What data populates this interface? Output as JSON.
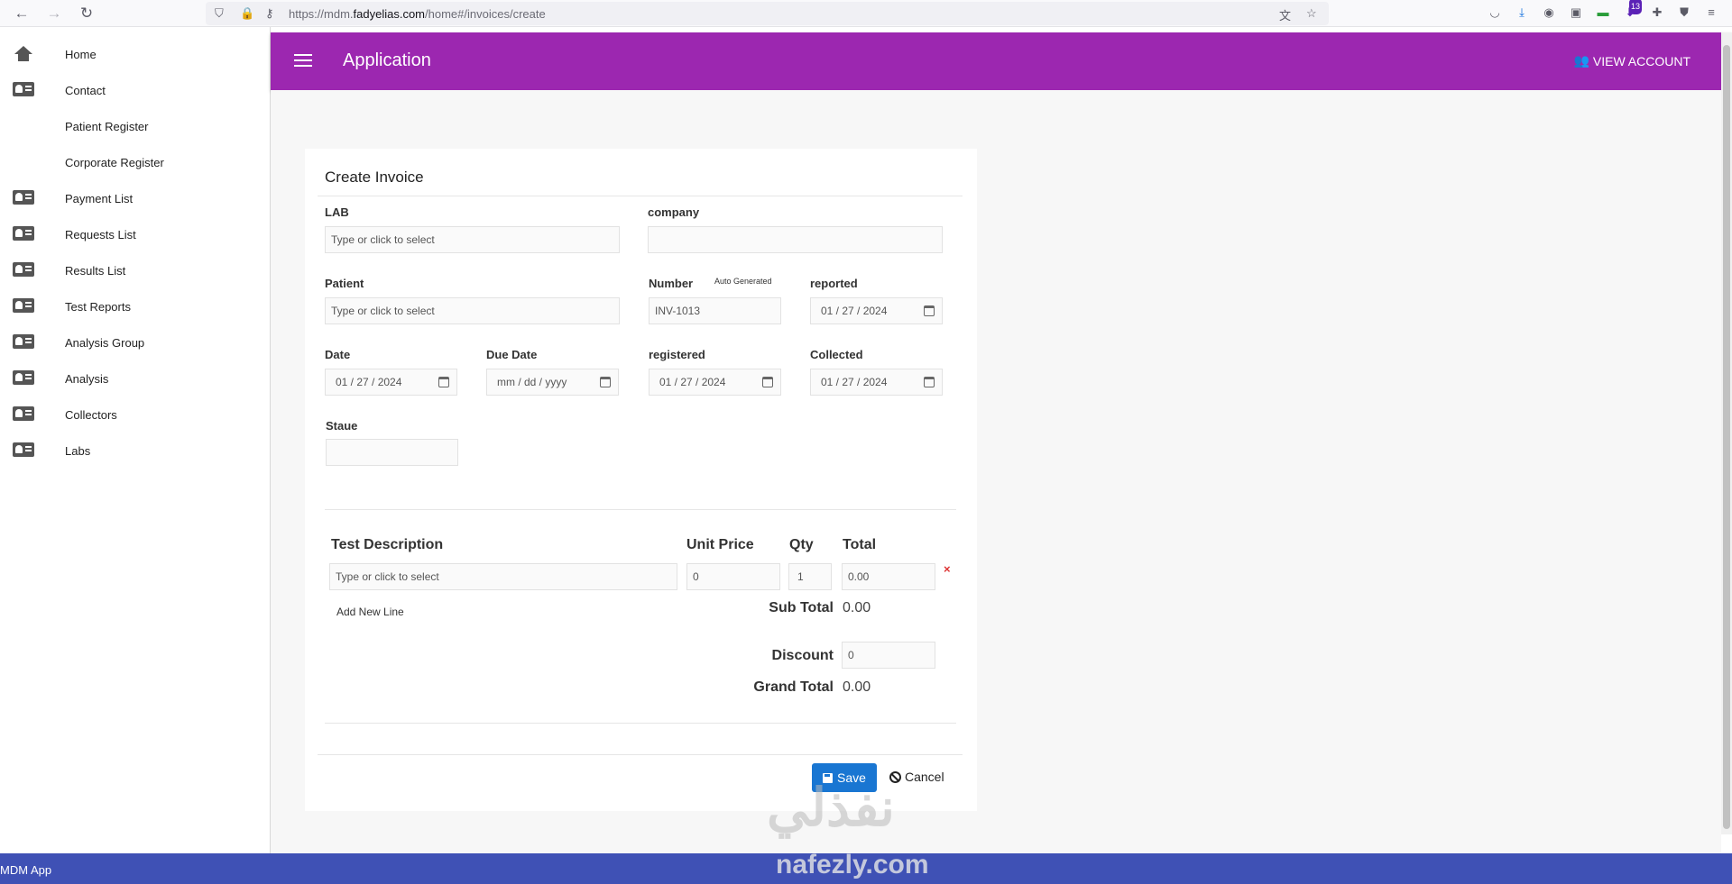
{
  "browser": {
    "url_prefix": "https://mdm.",
    "url_domain": "fadyelias.com",
    "url_path": "/home#/invoices/create",
    "notif_count": "13"
  },
  "sidebar": {
    "items": [
      {
        "label": "Home",
        "icon": "home-icon"
      },
      {
        "label": "Contact",
        "icon": "contact-card-icon"
      },
      {
        "label": "Patient Register",
        "icon": ""
      },
      {
        "label": "Corporate Register",
        "icon": ""
      },
      {
        "label": "Payment List",
        "icon": "contact-card-icon"
      },
      {
        "label": "Requests List",
        "icon": "contact-card-icon"
      },
      {
        "label": "Results List",
        "icon": "contact-card-icon"
      },
      {
        "label": "Test Reports",
        "icon": "contact-card-icon"
      },
      {
        "label": "Analysis Group",
        "icon": "contact-card-icon"
      },
      {
        "label": "Analysis",
        "icon": "contact-card-icon"
      },
      {
        "label": "Collectors",
        "icon": "contact-card-icon"
      },
      {
        "label": "Labs",
        "icon": "contact-card-icon"
      }
    ]
  },
  "appbar": {
    "title": "Application",
    "view_account": "VIEW ACCOUNT",
    "color": "#9c27b0"
  },
  "form": {
    "title": "Create Invoice",
    "lab": {
      "label": "LAB",
      "placeholder": "Type or click to select"
    },
    "company": {
      "label": "company",
      "value": ""
    },
    "patient": {
      "label": "Patient",
      "placeholder": "Type or click to select"
    },
    "number": {
      "label": "Number",
      "hint": "Auto Generated",
      "value": "INV-1013"
    },
    "reported": {
      "label": "reported",
      "value": "01 / 27 / 2024"
    },
    "date": {
      "label": "Date",
      "value": "01 / 27 / 2024"
    },
    "due_date": {
      "label": "Due Date",
      "value": "mm / dd / yyyy"
    },
    "registered": {
      "label": "registered",
      "value": "01 / 27 / 2024"
    },
    "collected": {
      "label": "Collected",
      "value": "01 / 27 / 2024"
    },
    "status": {
      "label": "Staue",
      "value": ""
    }
  },
  "table": {
    "headers": {
      "description": "Test Description",
      "unit_price": "Unit Price",
      "qty": "Qty",
      "total": "Total"
    },
    "row": {
      "description": "Type or click to select",
      "unit_price": "0",
      "qty": "1",
      "total": "0.00",
      "remove": "×"
    },
    "add_line": "Add New Line",
    "subtotal_label": "Sub Total",
    "subtotal": "0.00",
    "discount_label": "Discount",
    "discount": "0",
    "grand_total_label": "Grand Total",
    "grand_total": "0.00"
  },
  "actions": {
    "save": "Save",
    "cancel": "Cancel",
    "save_color": "#1976d2"
  },
  "footer": {
    "text": "MDM App",
    "color": "#3f51b5"
  },
  "watermark": {
    "arabic": "نفذلي",
    "latin": "nafezly.com"
  }
}
